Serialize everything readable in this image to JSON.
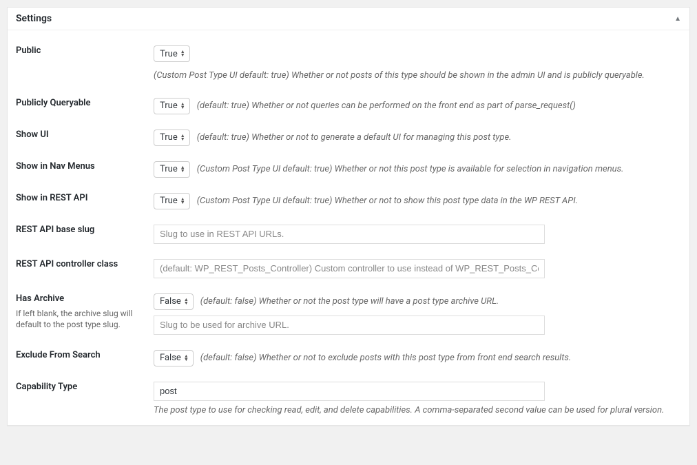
{
  "panel": {
    "title": "Settings"
  },
  "options": {
    "true": "True",
    "false": "False"
  },
  "fields": {
    "public": {
      "label": "Public",
      "value": "True",
      "desc": "(Custom Post Type UI default: true) Whether or not posts of this type should be shown in the admin UI and is publicly queryable."
    },
    "publicly_queryable": {
      "label": "Publicly Queryable",
      "value": "True",
      "desc": "(default: true) Whether or not queries can be performed on the front end as part of parse_request()"
    },
    "show_ui": {
      "label": "Show UI",
      "value": "True",
      "desc": "(default: true) Whether or not to generate a default UI for managing this post type."
    },
    "show_in_nav_menus": {
      "label": "Show in Nav Menus",
      "value": "True",
      "desc": "(Custom Post Type UI default: true) Whether or not this post type is available for selection in navigation menus."
    },
    "show_in_rest": {
      "label": "Show in REST API",
      "value": "True",
      "desc": "(Custom Post Type UI default: true) Whether or not to show this post type data in the WP REST API."
    },
    "rest_base": {
      "label": "REST API base slug",
      "placeholder": "Slug to use in REST API URLs.",
      "value": ""
    },
    "rest_controller_class": {
      "label": "REST API controller class",
      "placeholder": "(default: WP_REST_Posts_Controller) Custom controller to use instead of WP_REST_Posts_Cont",
      "value": ""
    },
    "has_archive": {
      "label": "Has Archive",
      "sublabel": "If left blank, the archive slug will default to the post type slug.",
      "value": "False",
      "desc": "(default: false) Whether or not the post type will have a post type archive URL.",
      "slug_placeholder": "Slug to be used for archive URL.",
      "slug_value": ""
    },
    "exclude_from_search": {
      "label": "Exclude From Search",
      "value": "False",
      "desc": "(default: false) Whether or not to exclude posts with this post type from front end search results."
    },
    "capability_type": {
      "label": "Capability Type",
      "value": "post",
      "desc": "The post type to use for checking read, edit, and delete capabilities. A comma-separated second value can be used for plural version."
    }
  }
}
